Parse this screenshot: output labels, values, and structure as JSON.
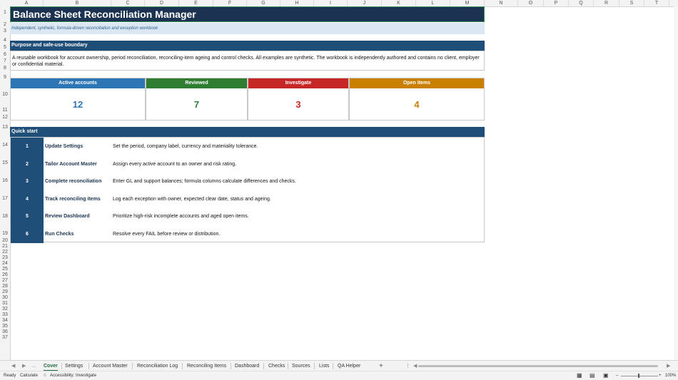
{
  "columns": [
    "A",
    "B",
    "C",
    "D",
    "E",
    "F",
    "G",
    "H",
    "I",
    "J",
    "K",
    "L",
    "M",
    "N",
    "O",
    "P",
    "Q",
    "R",
    "S",
    "T"
  ],
  "rows": [
    "1",
    "2",
    "3",
    "4",
    "5",
    "6",
    "7",
    "8",
    "9",
    "10",
    "11",
    "12",
    "13",
    "14",
    "15",
    "16",
    "17",
    "18",
    "19",
    "20",
    "21",
    "22",
    "23",
    "24",
    "25",
    "26",
    "27",
    "28",
    "29",
    "30",
    "31",
    "32",
    "33",
    "34",
    "35",
    "36",
    "37"
  ],
  "title": "Balance Sheet Reconciliation Manager",
  "subtitle": "Independent, synthetic, formula-driven reconciliation and exception workbook",
  "purpose": {
    "heading": "Purpose and safe-use boundary",
    "body": "A reusable workbook for account ownership, period reconciliation, reconciling-item ageing and control checks. All examples are synthetic. The workbook is independently authored and contains no client, employer or confidential material."
  },
  "kpis": [
    {
      "label": "Active accounts",
      "value": "12",
      "color": "#2e75b6"
    },
    {
      "label": "Reviewed",
      "value": "7",
      "color": "#2e7d32"
    },
    {
      "label": "Investigate",
      "value": "3",
      "color": "#c62828"
    },
    {
      "label": "Open items",
      "value": "4",
      "color": "#c98000"
    }
  ],
  "quickstart": {
    "heading": "Quick start",
    "steps": [
      {
        "num": "1",
        "title": "Update Settings",
        "desc": "Set the period, company label, currency and materiality tolerance."
      },
      {
        "num": "2",
        "title": "Tailor Account Master",
        "desc": "Assign every active account to an owner and risk rating."
      },
      {
        "num": "3",
        "title": "Complete reconciliation",
        "desc": "Enter GL and support balances; formula columns calculate differences and checks."
      },
      {
        "num": "4",
        "title": "Track reconciling items",
        "desc": "Log each exception with owner, expected clear date, status and ageing."
      },
      {
        "num": "5",
        "title": "Review Dashboard",
        "desc": "Prioritize high-risk incomplete accounts and aged open items."
      },
      {
        "num": "6",
        "title": "Run Checks",
        "desc": "Resolve every FAIL before review or distribution."
      }
    ]
  },
  "tabs": [
    "Cover",
    "Settings",
    "Account Master",
    "Reconciliation Log",
    "Reconciling Items",
    "Dashboard",
    "Checks",
    "Sources",
    "Lists",
    "QA Helper"
  ],
  "active_tab": "Cover",
  "status": {
    "ready": "Ready",
    "calculate": "Calculate",
    "accessibility": "Accessibility: Investigate",
    "zoom": "100%"
  }
}
